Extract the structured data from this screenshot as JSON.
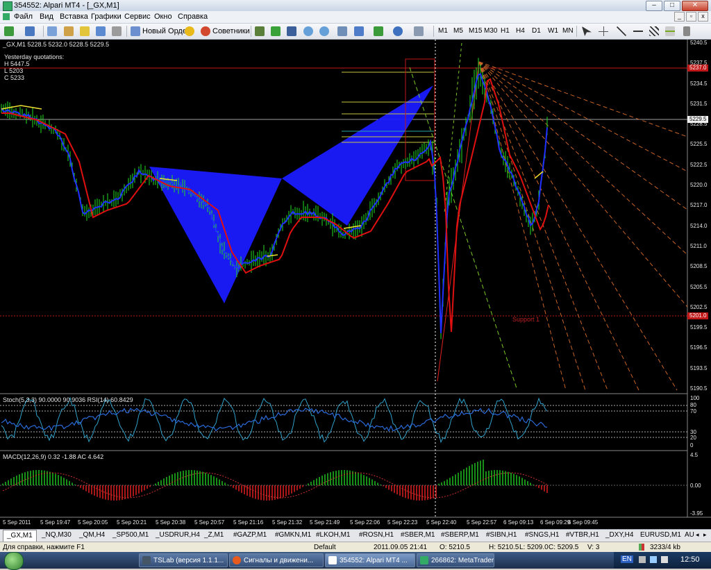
{
  "window": {
    "title": "354552: Alpari MT4 - [_GX,M1]"
  },
  "menu": [
    "Файл",
    "Вид",
    "Вставка",
    "Графики",
    "Сервис",
    "Окно",
    "Справка"
  ],
  "toolbar": {
    "new_order": "Новый Ордер",
    "advisors": "Советники",
    "timeframes": [
      "M1",
      "M5",
      "M15",
      "M30",
      "H1",
      "H4",
      "D1",
      "W1",
      "MN"
    ]
  },
  "chart": {
    "symbol_line": "_GX,M1  5228.5 5232.0 5228.5 5229.5",
    "yesterday": {
      "title": "Yesterday quotations:",
      "h": "H 5447.5",
      "l": "L 5203",
      "c": "C 5233"
    },
    "price_labels": [
      "5240.5",
      "5237.5",
      "5234.5",
      "5231.5",
      "5228.5",
      "5225.5",
      "5222.5",
      "5220.0",
      "5217.0",
      "5214.0",
      "5211.0",
      "5208.5",
      "5205.5",
      "5202.5",
      "5199.5",
      "5196.5",
      "5193.5",
      "5190.5"
    ],
    "current_price": "5229.5",
    "red_tag_top": "5237.0",
    "red_tag_support": "5201.0",
    "support_text": "Support 1"
  },
  "stoch": {
    "title": "Stoch(5,3,3) 90.0000 90.9036  RSI(14) 60.8429",
    "levels": [
      "100",
      "80",
      "70",
      "30",
      "20",
      "0"
    ]
  },
  "macd": {
    "title": "MACD(12,26,9) 0.32 -1.88  AC 4.642",
    "levels": [
      "4.5",
      "0.00",
      "-3.95"
    ]
  },
  "time_axis": [
    "5 Sep 2011",
    "5 Sep 19:47",
    "5 Sep 20:05",
    "5 Sep 20:21",
    "5 Sep 20:38",
    "5 Sep 20:57",
    "5 Sep 21:16",
    "5 Sep 21:32",
    "5 Sep 21:49",
    "5 Sep 22:06",
    "5 Sep 22:23",
    "5 Sep 22:40",
    "5 Sep 22:57",
    "6 Sep 09:13",
    "6 Sep 09:29",
    "6 Sep 09:45"
  ],
  "tabs": [
    "_GX,M1",
    "_NQ,M30",
    "_QM,H4",
    "_SP500,M1",
    "_USDRUR,H4",
    "_Z,M1",
    "#GAZP,M1",
    "#GMKN,M1",
    "#LKOH,M1",
    "#ROSN,H1",
    "#SBER,M1",
    "#SBERP,M1",
    "#SIBN,H1",
    "#SNGS,H1",
    "#VTBR,H1",
    "_DXY,H4",
    "EURUSD,M1",
    "AU"
  ],
  "status": {
    "help": "Для справки, нажмите F1",
    "profile": "Default",
    "time": "2011.09.05 21:41",
    "open": "O: 5210.5",
    "high": "H: 5210.5",
    "low": "L: 5209.0",
    "close": "C: 5209.5",
    "volume": "V: 3",
    "traffic": "3233/4 kb"
  },
  "taskbar": {
    "items": [
      "TSLab (версия 1.1.1...",
      "Сигналы и движени...",
      "354552: Alpari MT4 ...",
      "266862: MetaTrader ..."
    ],
    "lang": "EN",
    "clock": "12:50"
  }
}
